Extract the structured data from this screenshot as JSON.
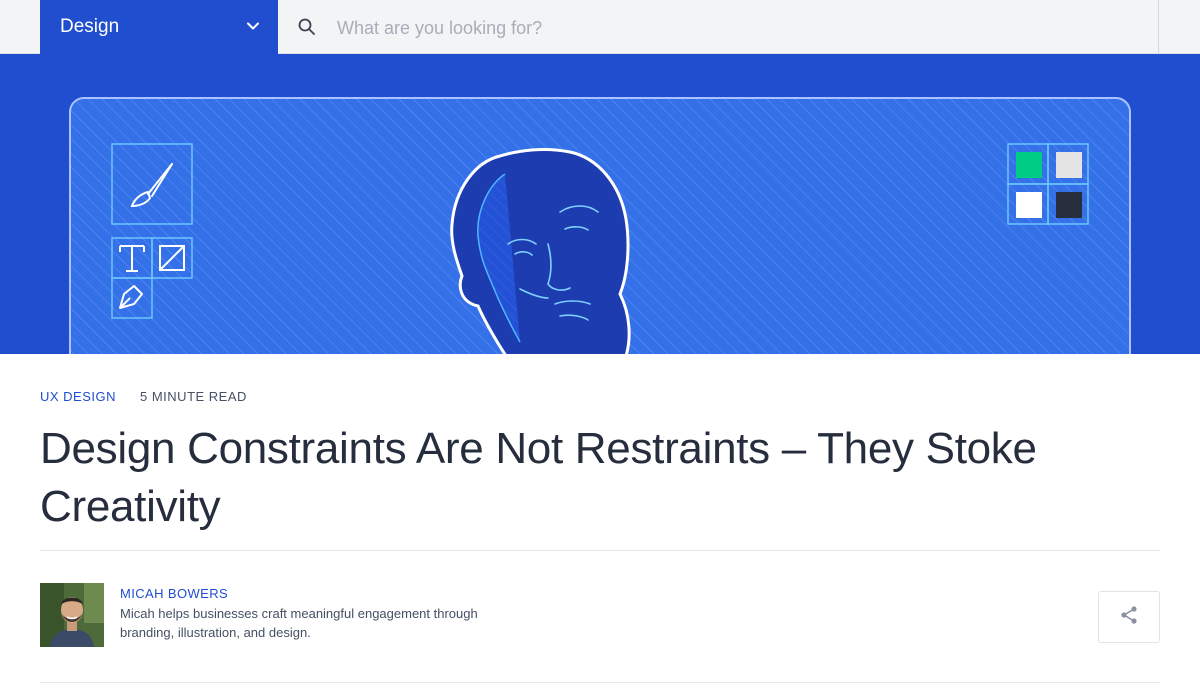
{
  "header": {
    "category_label": "Design",
    "search_placeholder": "What are you looking for?"
  },
  "article": {
    "tag": "UX DESIGN",
    "read_time": "5 MINUTE READ",
    "title": "Design Constraints Are Not Restraints – They Stoke Creativity"
  },
  "author": {
    "name": "MICAH BOWERS",
    "bio": "Micah helps businesses craft meaningful engagement through branding, illustration, and design."
  },
  "colors": {
    "brand_blue": "#204ecf",
    "swatch_1": "#00cc83",
    "swatch_2": "#e5e5e5",
    "swatch_3": "#ffffff",
    "swatch_4": "#262d3d"
  },
  "icons": {
    "category_chevron": "chevron-down-icon",
    "search": "search-icon",
    "share": "share-icon"
  }
}
